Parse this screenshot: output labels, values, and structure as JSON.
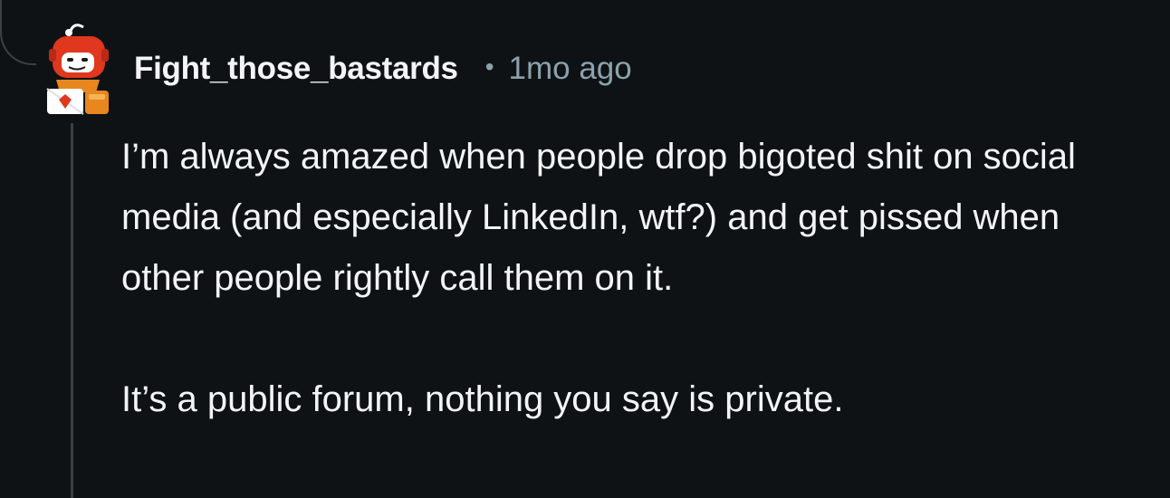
{
  "comment": {
    "username": "Fight_those_bastards",
    "separator": "•",
    "timestamp": "1mo ago",
    "paragraphs": [
      "I’m always amazed when people drop bigoted shit on social media (and especially LinkedIn, wtf?) and get pissed when other people rightly call them on it.",
      "It’s a public forum, nothing you say is private."
    ],
    "avatar_icon": "snoo-robot-avatar-icon"
  },
  "colors": {
    "background": "#0f1214",
    "text": "#f2f4f5",
    "meta": "#8ba2ad",
    "thread_line": "#3a4044",
    "avatar_red": "#e0371f",
    "avatar_orange": "#e8871e"
  }
}
